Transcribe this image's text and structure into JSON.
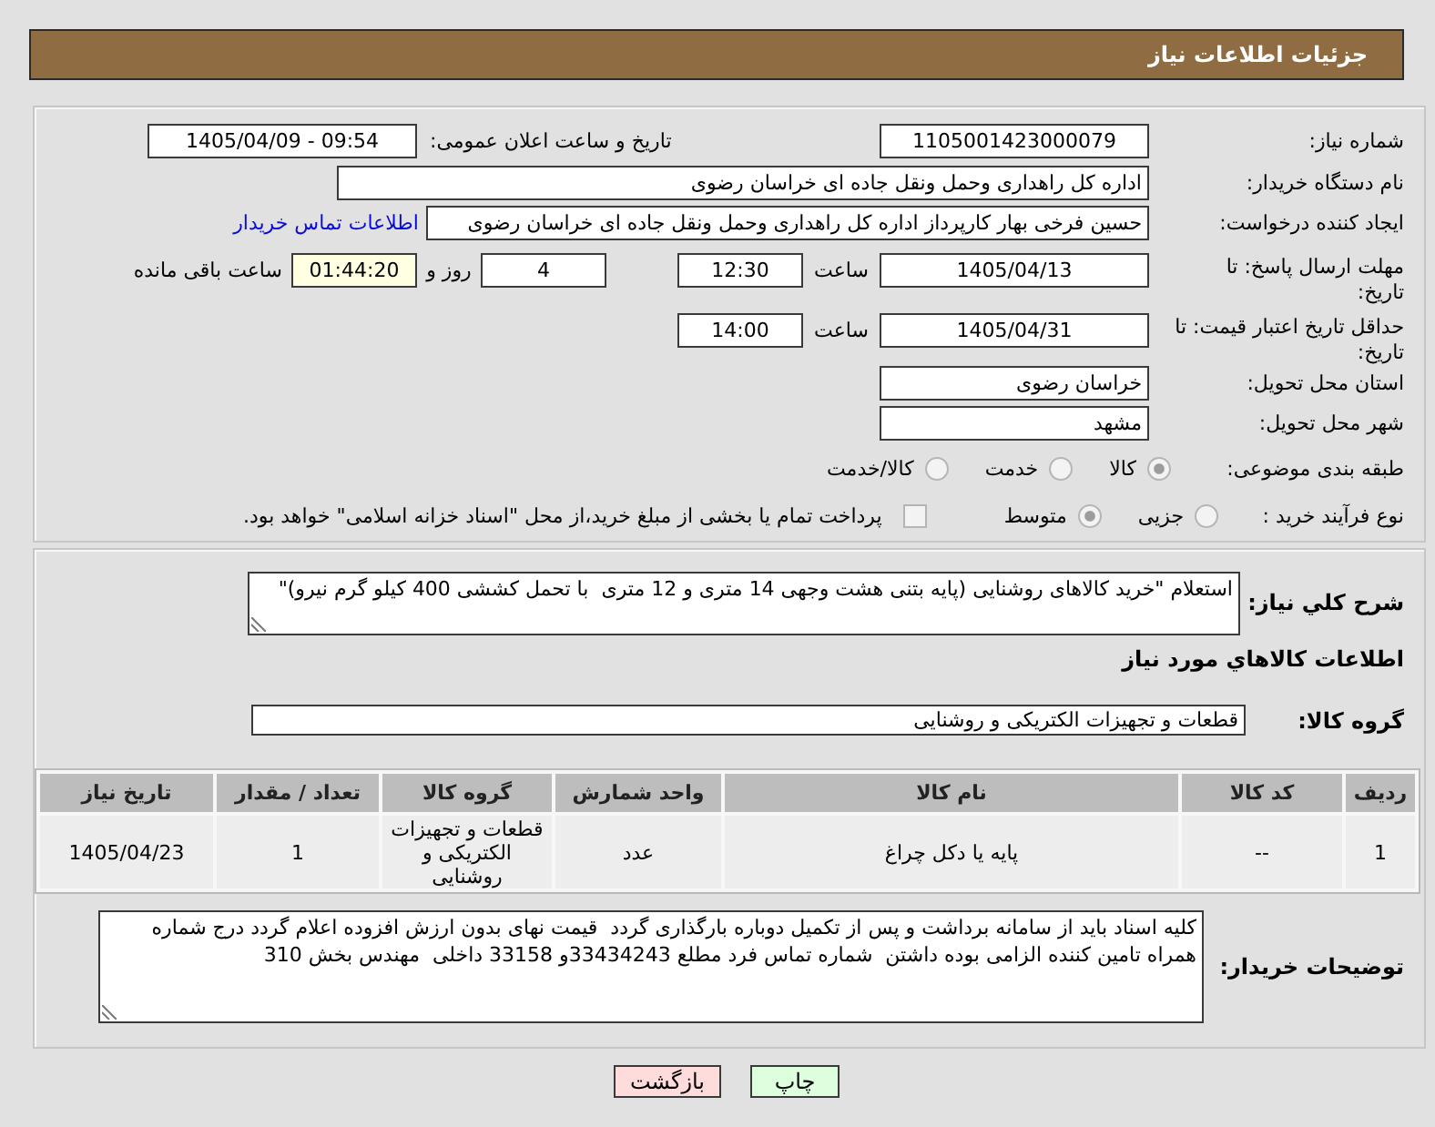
{
  "header": {
    "title": "جزئیات اطلاعات نیاز"
  },
  "need_number": {
    "label": "شماره نیاز:",
    "value": "1105001423000079"
  },
  "announce_date": {
    "label": "تاریخ و ساعت اعلان عمومی:",
    "value": "1405/04/09 - 09:54"
  },
  "buyer_org": {
    "label": "نام دستگاه خریدار:",
    "value": "اداره کل راهداری وحمل ونقل جاده ای خراسان رضوی"
  },
  "requester": {
    "label": "ایجاد کننده درخواست:",
    "value": "حسین فرخی بهار کارپرداز اداره کل راهداری وحمل ونقل جاده ای خراسان رضوی",
    "contact_link": "اطلاعات تماس خریدار"
  },
  "response_deadline": {
    "label": "مهلت ارسال پاسخ: تا تاریخ:",
    "date": "1405/04/13",
    "time_label": "ساعت",
    "time": "12:30",
    "days": "4",
    "days_label": "روز و",
    "remaining": "01:44:20",
    "remaining_label": "ساعت باقی مانده"
  },
  "price_validity": {
    "label": "حداقل تاریخ اعتبار قیمت: تا تاریخ:",
    "date": "1405/04/31",
    "time_label": "ساعت",
    "time": "14:00"
  },
  "province": {
    "label": "استان محل تحویل:",
    "value": "خراسان رضوی"
  },
  "city": {
    "label": "شهر محل تحویل:",
    "value": "مشهد"
  },
  "category": {
    "label": "طبقه بندی موضوعی:",
    "options": [
      {
        "label": "کالا",
        "selected": true
      },
      {
        "label": "خدمت",
        "selected": false
      },
      {
        "label": "کالا/خدمت",
        "selected": false
      }
    ]
  },
  "purchase_type": {
    "label": "نوع فرآیند خرید :",
    "options": [
      {
        "label": "جزیی",
        "selected": false
      },
      {
        "label": "متوسط",
        "selected": true
      }
    ],
    "treasury_payment": {
      "label": "پرداخت تمام یا بخشی از مبلغ خرید،از محل \"اسناد خزانه اسلامی\" خواهد بود.",
      "checked": false
    }
  },
  "description": {
    "label": "شرح کلي نياز:",
    "value": "استعلام \"خرید کالاهای روشنایی (پایه بتنی هشت وجهی 14 متری و 12 متری  با تحمل کششی 400 کیلو گرم نیرو)\""
  },
  "items": {
    "title": "اطلاعات کالاهاي مورد نياز",
    "group_label": "گروه کالا:",
    "group_value": "قطعات و تجهیزات الکتریکی و روشنایی",
    "table": {
      "columns": [
        "ردیف",
        "کد کالا",
        "نام کالا",
        "واحد شمارش",
        "گروه کالا",
        "تعداد / مقدار",
        "تاریخ نیاز"
      ],
      "rows": [
        [
          "1",
          "--",
          "پایه یا دکل چراغ",
          "عدد",
          "قطعات و تجهیزات الکتریکی و روشنایی",
          "1",
          "1405/04/23"
        ]
      ]
    }
  },
  "buyer_notes": {
    "label": "توضیحات خریدار:",
    "value": "کلیه اسناد باید از سامانه برداشت و پس از تکمیل دوباره بارگذاری گردد  قیمت نهای بدون ارزش افزوده اعلام گردد درج شماره همراه تامین کننده الزامی بوده داشتن  شماره تماس فرد مطلع 33434243و 33158 داخلی  مهندس بخش 310"
  },
  "buttons": [
    {
      "label": "چاپ",
      "kind": "print"
    },
    {
      "label": "بازگشت",
      "kind": "back"
    }
  ]
}
